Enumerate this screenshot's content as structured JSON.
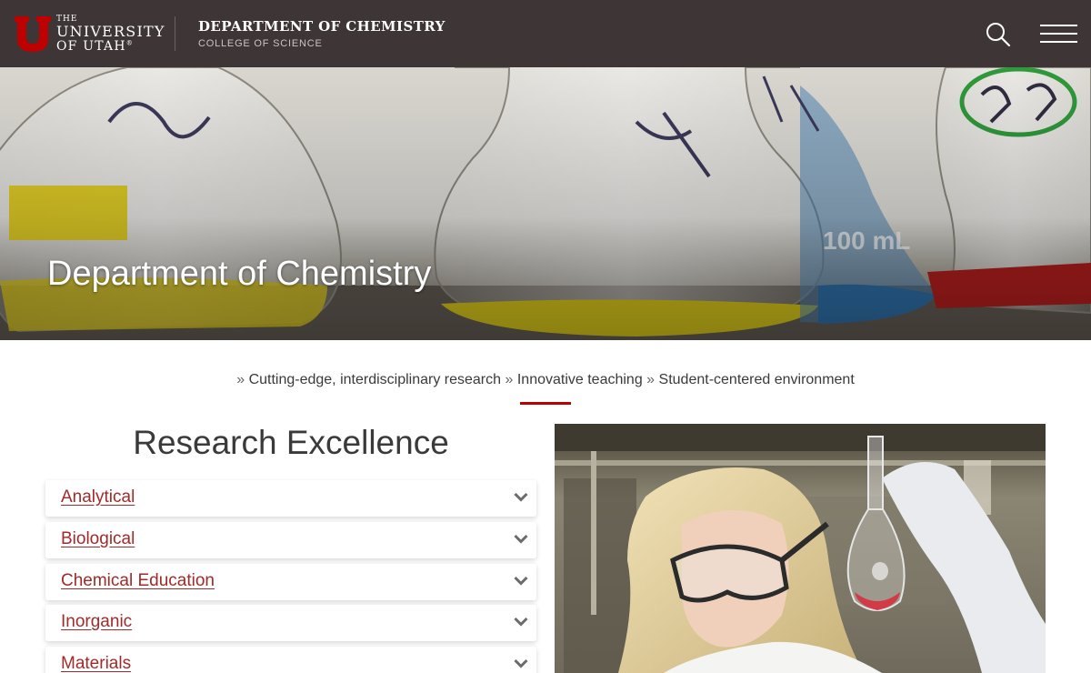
{
  "header": {
    "logo_the": "THE",
    "logo_university": "UNIVERSITY",
    "logo_of_utah": "OF UTAH",
    "logo_reg": "®",
    "department": "DEPARTMENT OF CHEMISTRY",
    "college": "COLLEGE OF SCIENCE",
    "icons": {
      "search": "search-icon",
      "menu": "hamburger-menu-icon"
    }
  },
  "hero": {
    "title": "Department of Chemistry"
  },
  "tagline": {
    "items": [
      "Cutting-edge, interdisciplinary research",
      "Innovative teaching",
      "Student-centered environment"
    ],
    "separator": "»"
  },
  "research": {
    "heading": "Research Excellence",
    "items": [
      {
        "label": "Analytical"
      },
      {
        "label": "Biological"
      },
      {
        "label": "Chemical Education"
      },
      {
        "label": "Inorganic"
      },
      {
        "label": "Materials"
      }
    ]
  },
  "colors": {
    "header_bg": "#3e3636",
    "brand_red": "#be0000",
    "link_red": "#a12a2a",
    "text_dark": "#3a3a3a"
  }
}
